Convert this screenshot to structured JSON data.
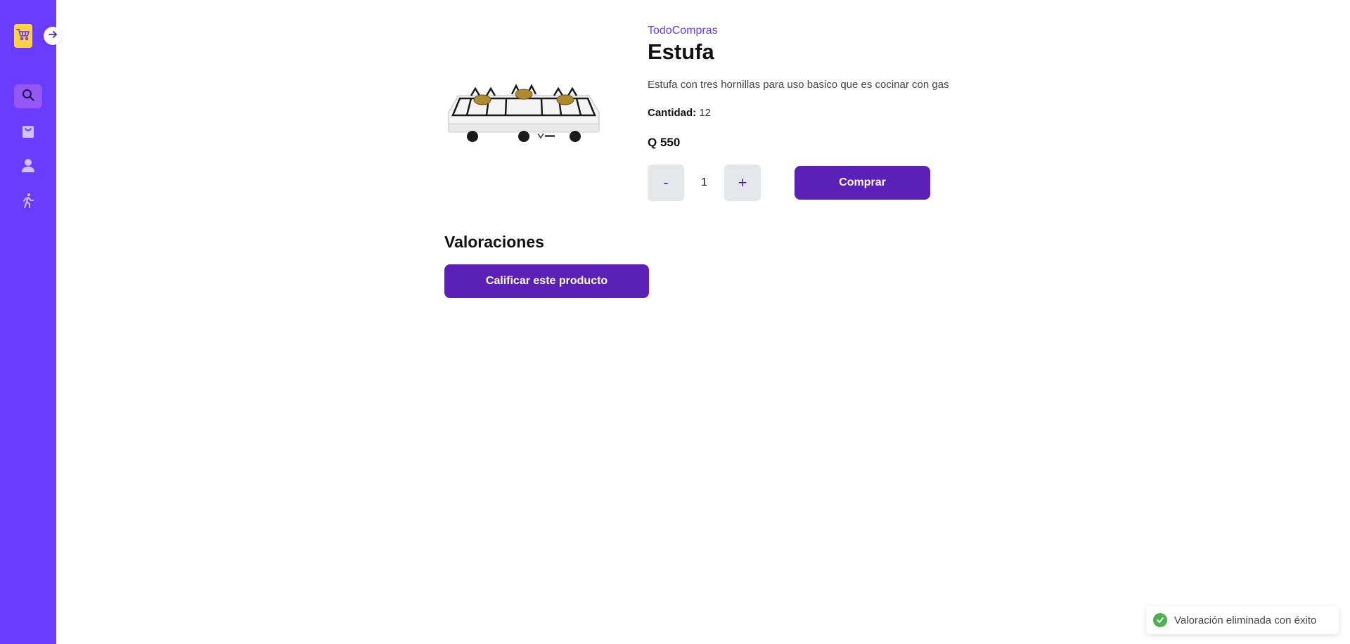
{
  "sidebar": {
    "logo_icon": "shopping-cart-icon",
    "toggle_icon": "arrow-right-icon",
    "items": [
      {
        "icon": "search-icon",
        "active": true
      },
      {
        "icon": "shopping-bag-icon",
        "active": false
      },
      {
        "icon": "user-icon",
        "active": false
      },
      {
        "icon": "walking-person-icon",
        "active": false
      }
    ],
    "colors": {
      "background": "#6a3cff",
      "active": "#9457f5",
      "logo": "#ffd23f"
    }
  },
  "product": {
    "brand": "TodoCompras",
    "name": "Estufa",
    "description": "Estufa con tres hornillas para uso basico que es cocinar con gas",
    "stock_label": "Cantidad:",
    "stock_value": "12",
    "price": "Q 550",
    "image_icon": "gas-stove-image"
  },
  "quantity": {
    "minus_label": "-",
    "value": "1",
    "plus_label": "+"
  },
  "buy_button": "Comprar",
  "ratings": {
    "title": "Valoraciones",
    "rate_button": "Calificar este producto"
  },
  "toast": {
    "message": "Valoración eliminada con éxito",
    "icon": "success-check-icon"
  },
  "colors": {
    "primary": "#5b21b6",
    "accent": "#6a3cff",
    "success": "#4caf50"
  }
}
